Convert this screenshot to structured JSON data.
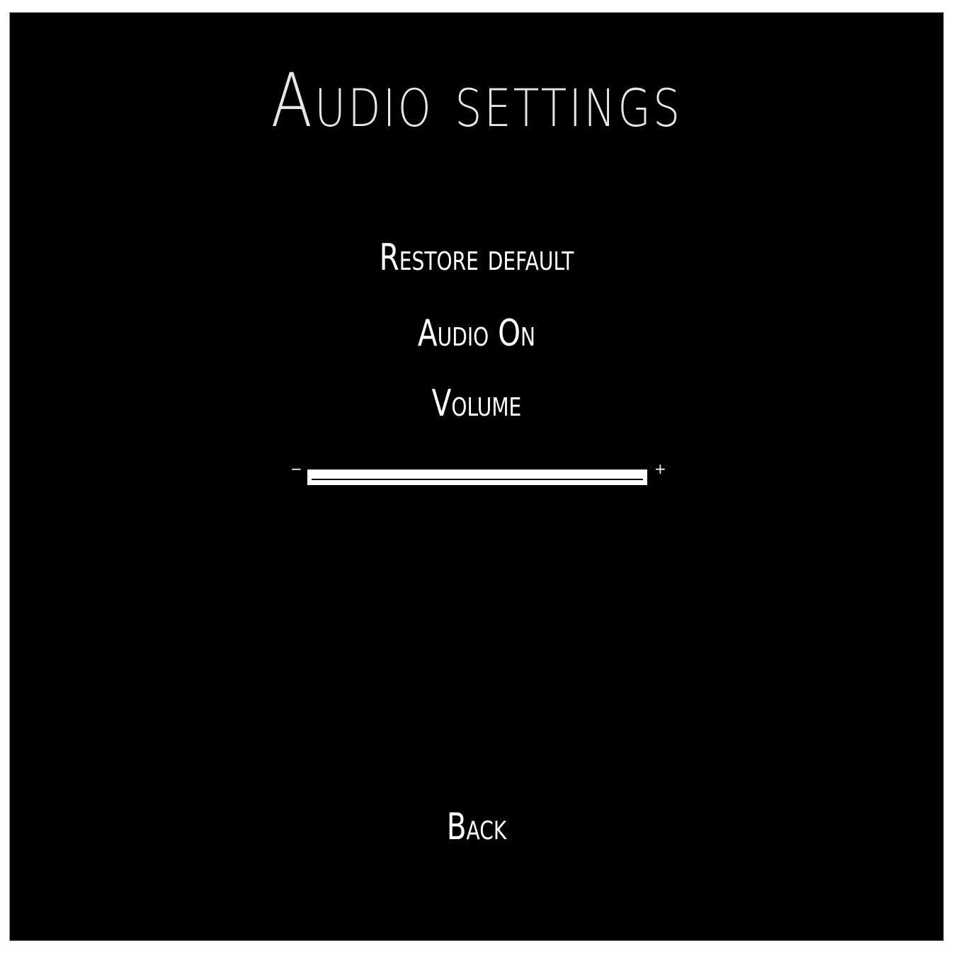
{
  "screen": {
    "title": "Audio settings",
    "background_color": "#000000",
    "text_color": "#ffffff"
  },
  "menu": {
    "restore_default": "Restore default",
    "audio_toggle": "Audio On",
    "volume_label": "Volume",
    "back": "Back"
  },
  "volume_slider": {
    "decrease_symbol": "−",
    "increase_symbol": "+",
    "level_fraction": 1.0
  }
}
